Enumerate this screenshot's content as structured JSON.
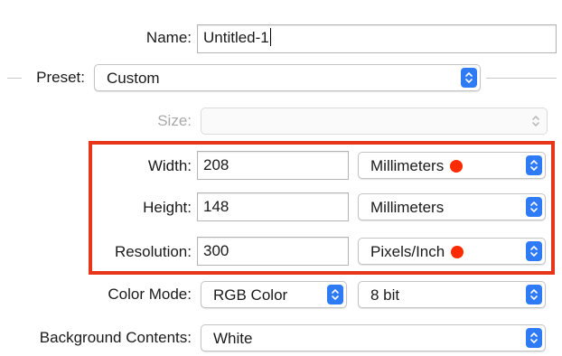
{
  "name": {
    "label": "Name:",
    "value": "Untitled-1"
  },
  "preset": {
    "label": "Preset:",
    "value": "Custom"
  },
  "size": {
    "label": "Size:",
    "value": ""
  },
  "width": {
    "label": "Width:",
    "value": "208",
    "unit": "Millimeters"
  },
  "height": {
    "label": "Height:",
    "value": "148",
    "unit": "Millimeters"
  },
  "resolution": {
    "label": "Resolution:",
    "value": "300",
    "unit": "Pixels/Inch"
  },
  "color_mode": {
    "label": "Color Mode:",
    "value": "RGB Color",
    "depth": "8 bit"
  },
  "background": {
    "label": "Background Contents:",
    "value": "White"
  },
  "colors": {
    "accent": "#2f7bf5",
    "highlight_border": "#e8361b",
    "marker_dot": "#ff2b00"
  }
}
